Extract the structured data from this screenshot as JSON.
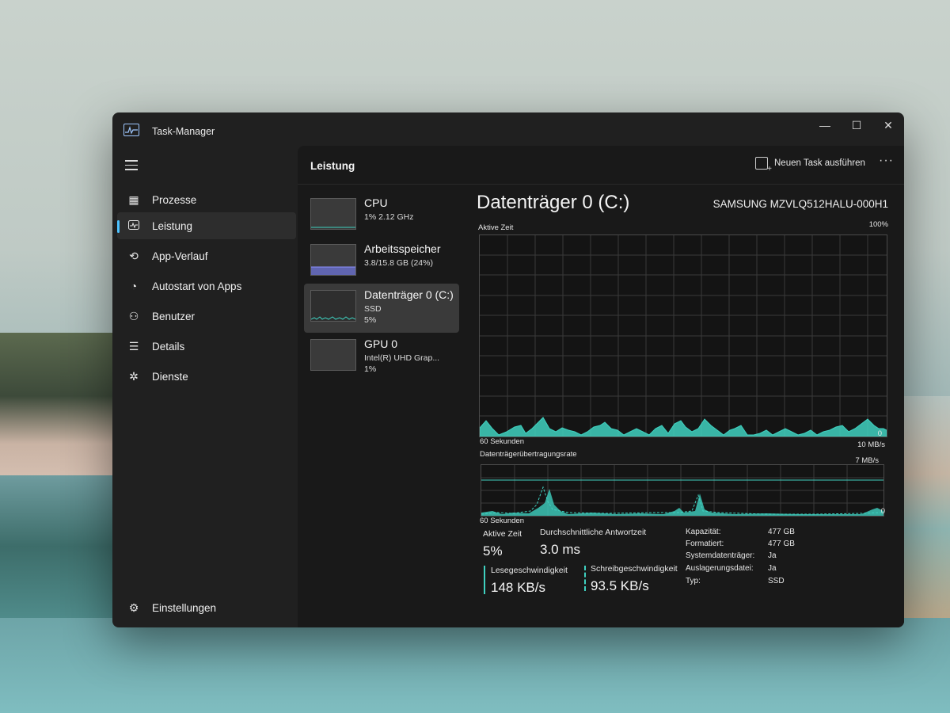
{
  "window": {
    "title": "Task-Manager"
  },
  "sidebar": {
    "items": [
      {
        "label": "Prozesse",
        "icon": "processes-icon",
        "active": false
      },
      {
        "label": "Leistung",
        "icon": "performance-icon",
        "active": true
      },
      {
        "label": "App-Verlauf",
        "icon": "history-icon",
        "active": false
      },
      {
        "label": "Autostart von Apps",
        "icon": "startup-icon",
        "active": false
      },
      {
        "label": "Benutzer",
        "icon": "users-icon",
        "active": false
      },
      {
        "label": "Details",
        "icon": "details-icon",
        "active": false
      },
      {
        "label": "Dienste",
        "icon": "services-icon",
        "active": false
      }
    ],
    "settings_label": "Einstellungen"
  },
  "header": {
    "title": "Leistung",
    "run_task_label": "Neuen Task ausführen",
    "more_label": "···"
  },
  "devices": [
    {
      "name": "CPU",
      "sub": "1% 2.12 GHz",
      "sub2": ""
    },
    {
      "name": "Arbeitsspeicher",
      "sub": "3.8/15.8 GB (24%)",
      "sub2": ""
    },
    {
      "name": "Datenträger 0 (C:)",
      "sub": "SSD",
      "sub2": "5%"
    },
    {
      "name": "GPU 0",
      "sub": "Intel(R) UHD Grap...",
      "sub2": "1%"
    }
  ],
  "detail": {
    "title": "Datenträger 0 (C:)",
    "model": "SAMSUNG MZVLQ512HALU-000H1",
    "graph1_label": "Aktive Zeit",
    "graph1_max": "100%",
    "graph1_min": "0",
    "graph1_time": "60 Sekunden",
    "graph2_label": "Datenträgerübertragungsrate",
    "graph2_max": "10 MB/s",
    "graph2_line": "7 MB/s",
    "graph2_min": "0",
    "graph2_time": "60 Sekunden"
  },
  "stats": {
    "active_time_label": "Aktive Zeit",
    "active_time_value": "5%",
    "response_label": "Durchschnittliche Antwortzeit",
    "response_value": "3.0 ms",
    "read_label": "Lesegeschwindigkeit",
    "read_value": "148 KB/s",
    "write_label": "Schreibgeschwindigkeit",
    "write_value": "93.5 KB/s"
  },
  "properties": [
    {
      "key": "Kapazität:",
      "value": "477 GB"
    },
    {
      "key": "Formatiert:",
      "value": "477 GB"
    },
    {
      "key": "Systemdatenträger:",
      "value": "Ja"
    },
    {
      "key": "Auslagerungsdatei:",
      "value": "Ja"
    },
    {
      "key": "Typ:",
      "value": "SSD"
    }
  ],
  "colors": {
    "accent": "#4cc2ff",
    "graph": "#3fd1c0",
    "memory": "#6d74d8"
  }
}
